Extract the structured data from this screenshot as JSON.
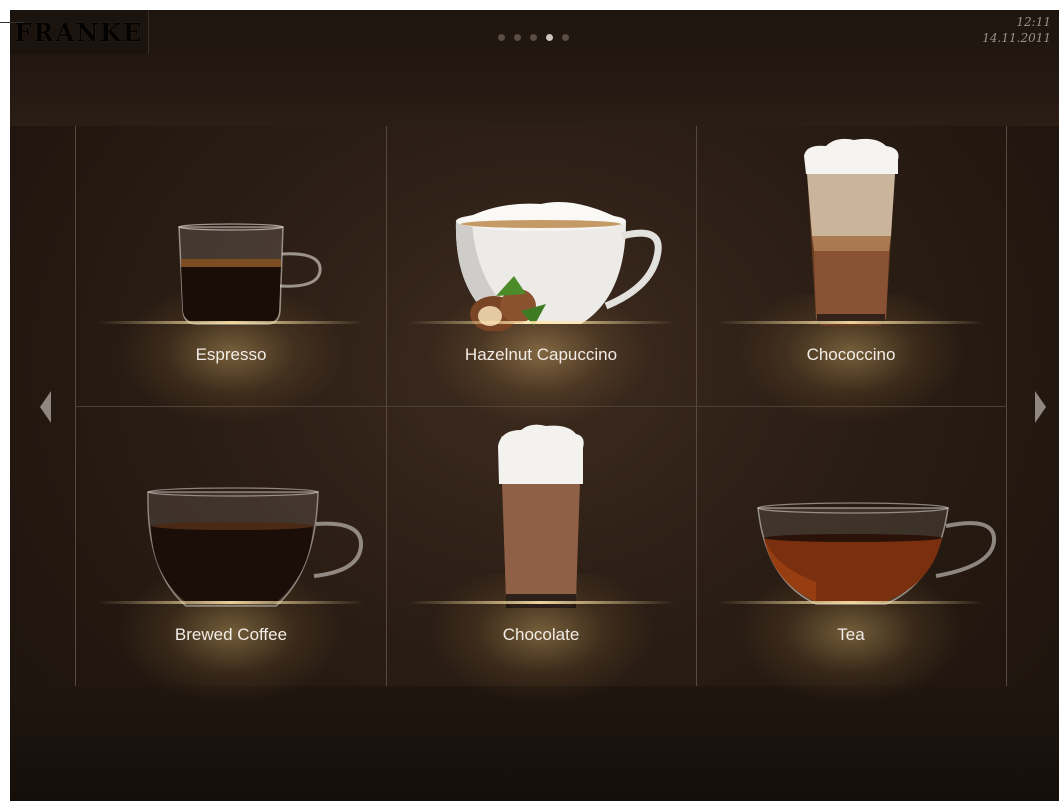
{
  "header": {
    "logo_text": "FRANKE",
    "time": "12:11",
    "date": "14.11.2011",
    "page_dots": 5,
    "active_page_index": 3
  },
  "drinks": [
    {
      "label": "Espresso",
      "icon": "espresso-cup-icon"
    },
    {
      "label": "Hazelnut Capuccino",
      "icon": "cappuccino-cup-icon"
    },
    {
      "label": "Chococcino",
      "icon": "latte-glass-icon"
    },
    {
      "label": "Brewed Coffee",
      "icon": "coffee-cup-icon"
    },
    {
      "label": "Chocolate",
      "icon": "chocolate-glass-icon"
    },
    {
      "label": "Tea",
      "icon": "tea-cup-icon"
    }
  ],
  "colors": {
    "background": "#2a1d14",
    "label_text": "#f2ece6",
    "active_dot": "#cfc5bd"
  }
}
